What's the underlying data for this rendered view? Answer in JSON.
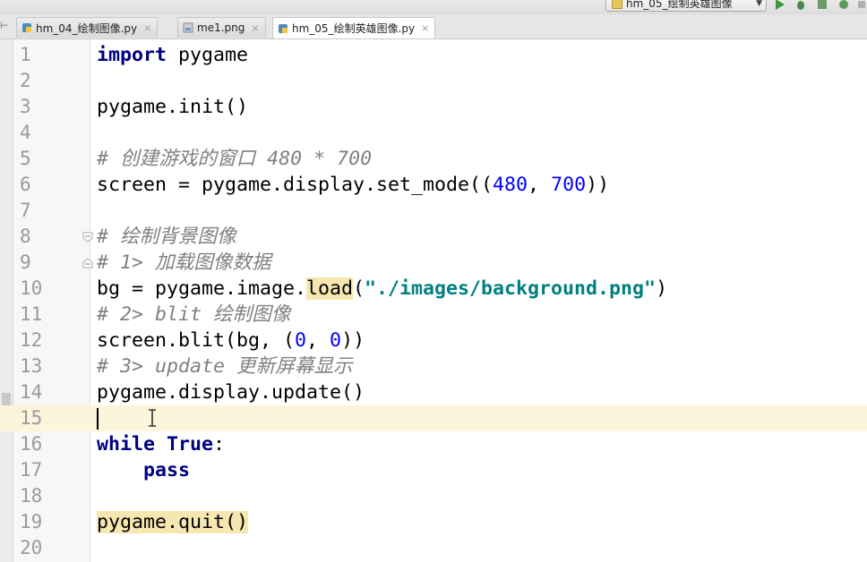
{
  "toolbar": {
    "run_config": "hm_05_绘制英雄图像"
  },
  "tabs": [
    {
      "label": "hm_04_绘制图像.py",
      "type": "python",
      "active": false
    },
    {
      "label": "me1.png",
      "type": "image",
      "active": false
    },
    {
      "label": "hm_05_绘制英雄图像.py",
      "type": "python",
      "active": true
    }
  ],
  "editor": {
    "current_line": 15,
    "lines": [
      {
        "n": "1"
      },
      {
        "n": "2"
      },
      {
        "n": "3"
      },
      {
        "n": "4"
      },
      {
        "n": "5"
      },
      {
        "n": "6"
      },
      {
        "n": "7"
      },
      {
        "n": "8"
      },
      {
        "n": "9"
      },
      {
        "n": "10"
      },
      {
        "n": "11"
      },
      {
        "n": "12"
      },
      {
        "n": "13"
      },
      {
        "n": "14"
      },
      {
        "n": "15"
      },
      {
        "n": "16"
      },
      {
        "n": "17"
      },
      {
        "n": "18"
      },
      {
        "n": "19"
      },
      {
        "n": "20"
      }
    ],
    "code": {
      "l1_kw": "import",
      "l1_rest": " pygame",
      "l3": "pygame.init()",
      "l5": "# 创建游戏的窗口 480 * 700",
      "l6_a": "screen = pygame.display.set_mode((",
      "l6_n1": "480",
      "l6_b": ", ",
      "l6_n2": "700",
      "l6_c": "))",
      "l8": "# 绘制背景图像",
      "l9": "# 1> 加载图像数据",
      "l10_a": "bg = pygame.image.",
      "l10_fn": "load",
      "l10_b": "(",
      "l10_str": "\"./images/background.png\"",
      "l10_c": ")",
      "l11": "# 2> blit 绘制图像",
      "l12_a": "screen.blit(bg, (",
      "l12_n1": "0",
      "l12_b": ", ",
      "l12_n2": "0",
      "l12_c": "))",
      "l13": "# 3> update 更新屏幕显示",
      "l14": "pygame.display.update()",
      "l16_kw1": "while",
      "l16_sp": " ",
      "l16_kw2": "True",
      "l16_colon": ":",
      "l17_indent": "    ",
      "l17_kw": "pass",
      "l19": "pygame.quit()"
    }
  },
  "colors": {
    "keyword": "#000080",
    "number": "#0000ff",
    "string": "#008080",
    "comment": "#808080",
    "current_line": "#fbf5dc",
    "highlight": "#f6e7b0"
  }
}
